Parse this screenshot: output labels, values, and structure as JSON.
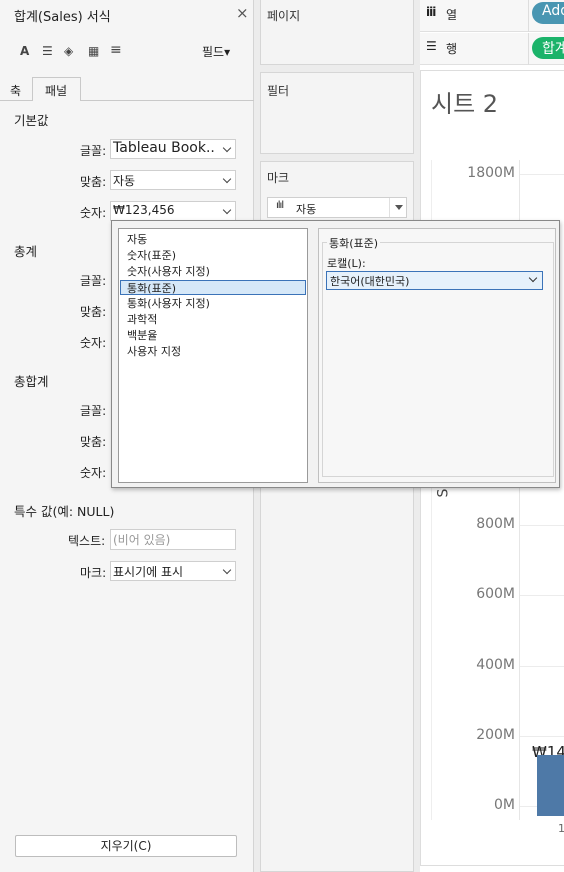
{
  "format_pane": {
    "title": "합계(Sales) 서식",
    "close_glyph": "×",
    "toolbar": {
      "font_glyph": "A",
      "align_glyph": "☰",
      "fill_glyph": "◈",
      "border_glyph": "▦",
      "lines_glyph": "≡",
      "fields_label": "필드▾"
    },
    "tabs": [
      "축",
      "패널"
    ],
    "default_section": {
      "heading": "기본값",
      "font_label": "글꼴:",
      "font_value": "Tableau Book..",
      "align_label": "맞춤:",
      "align_value": "자동",
      "number_label": "숫자:",
      "number_value": "₩123,456"
    },
    "totals_section": {
      "heading": "총계",
      "font_label": "글꼴:",
      "align_label": "맞춤:",
      "number_label": "숫자:"
    },
    "grand_totals_section": {
      "heading": "총합계",
      "font_label": "글꼴:",
      "align_label": "맞춤:",
      "number_label": "숫자:"
    },
    "special_values": {
      "heading": "특수 값(예: NULL)",
      "text_label": "텍스트:",
      "text_placeholder": "(비어 있음)",
      "mark_label": "마크:",
      "mark_value": "표시기에 표시"
    },
    "clear_button": "지우기(C)"
  },
  "number_format_popup": {
    "items": [
      "자동",
      "숫자(표준)",
      "숫자(사용자 지정)",
      "통화(표준)",
      "통화(사용자 지정)",
      "과학적",
      "백분율",
      "사용자 지정"
    ],
    "selected_index": 3,
    "group_title": "통화(표준)",
    "locale_label": "로캘(L):",
    "locale_value": "한국어(대한민국)"
  },
  "shelves": {
    "pages_label": "페이지",
    "filters_label": "필터",
    "marks_label": "마크",
    "marks_type": "자동",
    "columns_icon": "iii",
    "columns_label": "열",
    "columns_pill": "Add",
    "rows_icon": "☰",
    "rows_label": "행",
    "rows_pill": "합계"
  },
  "sheet": {
    "title": "시트 2",
    "axis_letter": "S",
    "bar_label": "₩14",
    "x_fragment": "1"
  },
  "chart_data": {
    "type": "bar",
    "title": "",
    "ylim": [
      0,
      1800
    ],
    "yticks": [
      "1800M",
      "800M",
      "600M",
      "400M",
      "200M",
      "0M"
    ],
    "ytick_values": [
      1800,
      800,
      600,
      400,
      200,
      0
    ],
    "values": [
      146
    ],
    "grid": true,
    "colors": {
      "bar": "#4e79a7",
      "pill_green": "#1bb36a",
      "pill_teal": "#4996b2"
    }
  }
}
